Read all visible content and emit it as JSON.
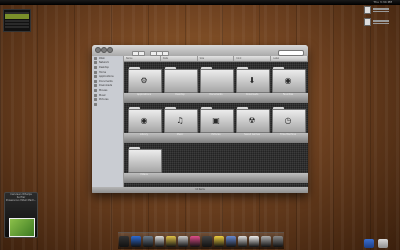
{
  "menubar": {
    "apple": "",
    "clock": "Thu 3:34 PM"
  },
  "widget": {
    "title": "",
    "rows": [
      false,
      true,
      true,
      false,
      false,
      false
    ]
  },
  "itunes": {
    "line1": "Cerulean Wharps",
    "line2": "Surfrer",
    "line3": "Powerenvo Mdwl Madr..."
  },
  "finder": {
    "columns": [
      "Name",
      "Date",
      "Size",
      "Kind",
      "Label"
    ],
    "sidebar": [
      {
        "label": "iDisk",
        "head": false
      },
      {
        "label": "Network",
        "head": false
      },
      {
        "label": "Desktop",
        "head": false
      },
      {
        "label": "Home",
        "head": false
      },
      {
        "label": "Applications",
        "head": false
      },
      {
        "label": "Documents",
        "head": false
      },
      {
        "label": "Downloads",
        "head": false
      },
      {
        "label": "Movies",
        "head": false
      },
      {
        "label": "Music",
        "head": false
      },
      {
        "label": "Pictures",
        "head": false
      },
      {
        "label": "",
        "head": false
      }
    ],
    "folders": [
      {
        "label": "Applications",
        "glyph": "⚙"
      },
      {
        "label": "Desktop",
        "glyph": ""
      },
      {
        "label": "Documents",
        "glyph": ""
      },
      {
        "label": "Downloads",
        "glyph": "⬇"
      },
      {
        "label": "Favorites",
        "glyph": "◉"
      },
      {
        "label": "Library",
        "glyph": "◉"
      },
      {
        "label": "Music",
        "glyph": "♫"
      },
      {
        "label": "Pictures",
        "glyph": "▣"
      },
      {
        "label": "Saved Games",
        "glyph": "☢"
      },
      {
        "label": "Time Machine",
        "glyph": "◷"
      },
      {
        "label": "Videos",
        "glyph": ""
      }
    ],
    "status": "12 items"
  },
  "dock": {
    "icons": [
      "#333333",
      "#2d6cd4",
      "#6a7a8a",
      "#dddddd",
      "#e1c34a",
      "#cccccc",
      "#e04e8a",
      "#444444",
      "#f0d040",
      "#6a8ad0",
      "#dddddd",
      "#eeeeee",
      "#b0b0b0",
      "#888888"
    ]
  }
}
